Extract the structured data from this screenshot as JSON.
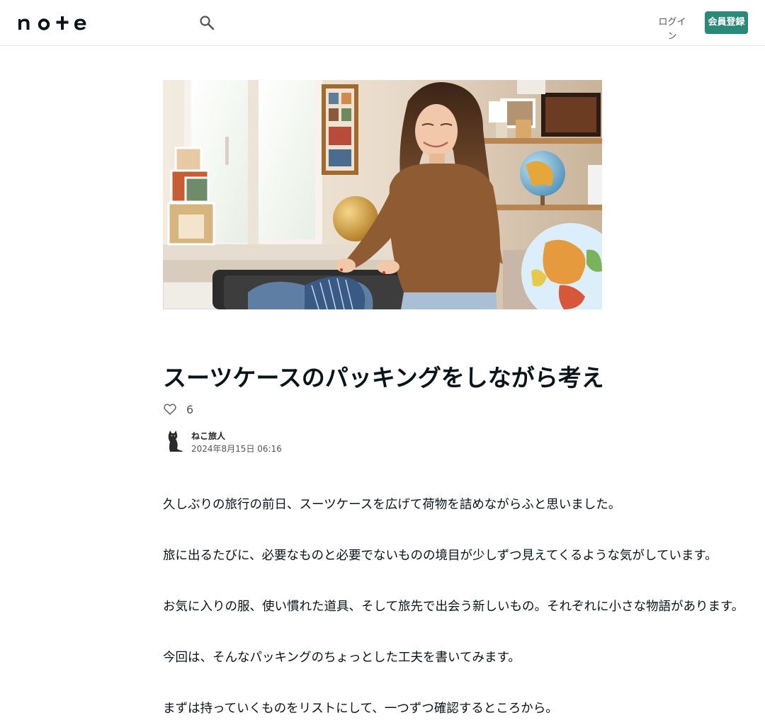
{
  "header": {
    "logo_text": "note",
    "login_label": "ログイン",
    "signup_label": "会員登録"
  },
  "article": {
    "title": "スーツケースのパッキングをしながら考えた、旅と暮らしのちいさな工夫",
    "like_count": "6",
    "author": {
      "name": "ねこ旅人",
      "date": "2024年8月15日 06:16"
    },
    "paragraphs": [
      "久しぶりの旅行の前日、スーツケースを広げて荷物を詰めながらふと思いました。",
      "旅に出るたびに、必要なものと必要でないものの境目が少しずつ見えてくるような気がしています。",
      "お気に入りの服、使い慣れた道具、そして旅先で出会う新しいもの。それぞれに小さな物語があります。",
      "今回は、そんなパッキングのちょっとした工夫を書いてみます。",
      "まずは持っていくものをリストにして、一つずつ確認するところから。"
    ]
  }
}
